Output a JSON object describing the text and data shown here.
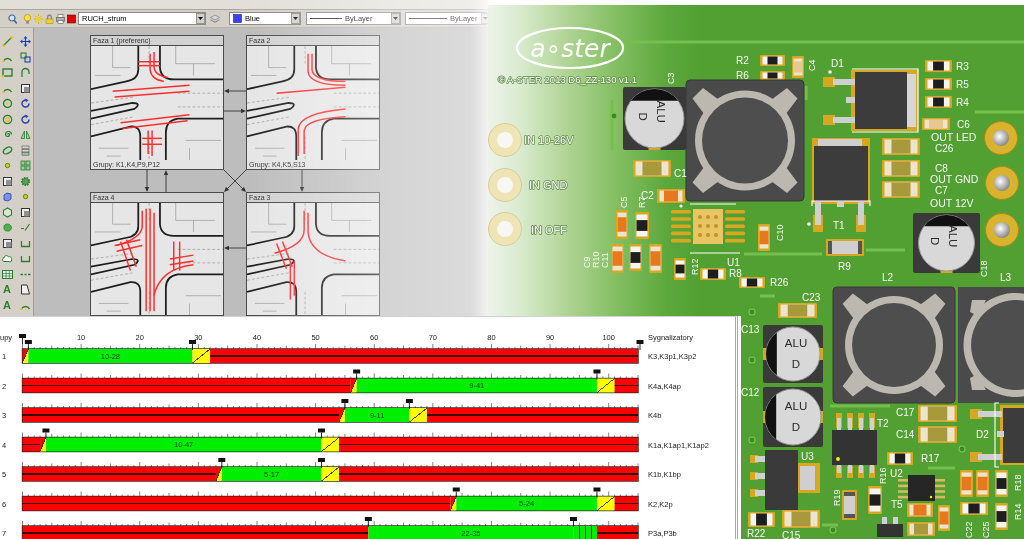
{
  "cad_window": {
    "layer_toolbar": {
      "layer": "RUCH_strum",
      "color_dropdown": "Blue",
      "linetype": "ByLayer",
      "lineweight": "ByLayer"
    },
    "draw_toolbar": {
      "text_tools": [
        "A",
        "A"
      ]
    },
    "phases": [
      {
        "title": "Faza 1 (preferenc)",
        "caption": "Grupy: K1,K4,P9,P12"
      },
      {
        "title": "Faza 2",
        "caption": "Grupy: K4,K5,S13"
      },
      {
        "title": "Faza 4"
      },
      {
        "title": "Faza 3"
      }
    ]
  },
  "timing_chart": {
    "group_header": "upy",
    "signals_header": "Sygnalizatory",
    "signals": [
      "K3,K3p1,K3p2",
      "K4a,K4ap",
      "K4b",
      "K1a,K1ap1,K1ap2",
      "K1b,K1bp",
      "K2,K2p",
      "P3a,P3b"
    ],
    "segment_kinds": [
      {
        "kind": "lined"
      },
      {
        "kind": "split"
      },
      {
        "kind": "solid"
      },
      {
        "kind": "striped"
      },
      {
        "kind": "slashed"
      },
      {
        "kind": "lined"
      }
    ],
    "chart_data": {
      "type": "bar",
      "orientation": "horizontal",
      "stacked": true,
      "categories": [
        "1",
        "2",
        "3",
        "4",
        "5",
        "6",
        "7"
      ],
      "xlim": [
        0,
        105
      ],
      "xticks": [
        10,
        20,
        30,
        40,
        50,
        60,
        70,
        80,
        90,
        100
      ],
      "series": [
        {
          "color": "#ff0000",
          "values": [
            0,
            56,
            54,
            3,
            33,
            73,
            59
          ]
        },
        {
          "color": "#ffff00",
          "values": [
            1,
            1,
            1,
            1,
            1,
            1,
            0
          ]
        },
        {
          "color": "#00ee00",
          "values": [
            28,
            41,
            11,
            47,
            17,
            24,
            35
          ]
        },
        {
          "color": "#00ee00",
          "values": [
            0,
            0,
            0,
            0,
            0,
            0,
            4
          ]
        },
        {
          "color": "#ffff00",
          "values": [
            3,
            3,
            3,
            3,
            3,
            3,
            0
          ]
        },
        {
          "color": "#ff0000",
          "values": [
            73,
            4,
            36,
            51,
            51,
            4,
            7
          ]
        }
      ],
      "annotations": [
        "10-28",
        "9-41",
        "9-11",
        "10-47",
        "5-17",
        "5-24",
        "22-35"
      ]
    }
  },
  "pcb": {
    "logo": "a∘ster",
    "copyright": "© A-STER 2013 D6_ZZ-130 v1.1",
    "input_pads": [
      "IN 10-26V",
      "IN GND",
      "IN OFF"
    ],
    "output_pads": [
      "OUT LED",
      "OUT GND",
      "OUT 12V"
    ],
    "capacitor_marks": [
      {
        "line_1": "ALU",
        "line_2": "D"
      },
      {
        "line_1": "ALU",
        "line_2": "D"
      },
      {
        "line_1": "ALU",
        "line_2": "D"
      },
      {
        "line_1": "ALU",
        "line_2": "D"
      }
    ],
    "designators": [
      "R2",
      "C4",
      "D1",
      "R3",
      "C3",
      "R6",
      "R5",
      "R4",
      "C6",
      "C26",
      "C8",
      "C1",
      "C7",
      "C2",
      "C5",
      "R7",
      "T1",
      "C10",
      "C9",
      "R10",
      "C11",
      "R12",
      "U1",
      "C18",
      "R9",
      "R8",
      "L2",
      "L3",
      "R26",
      "C23",
      "C13",
      "C12",
      "C17",
      "T2",
      "C14",
      "D2",
      "U3",
      "R17",
      "U2",
      "R16",
      "R18",
      "R19",
      "T5",
      "R14",
      "C22",
      "C25",
      "R22",
      "C15"
    ]
  }
}
